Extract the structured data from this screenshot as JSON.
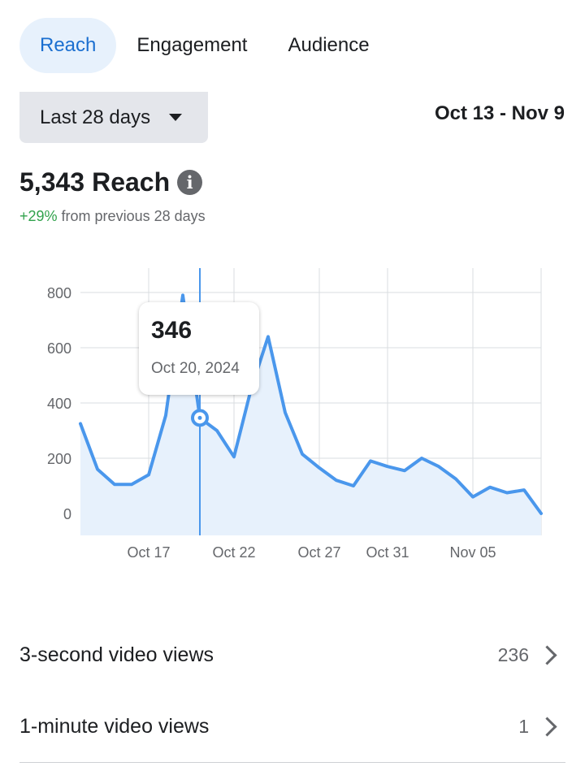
{
  "tabs": [
    {
      "label": "Reach",
      "active": true
    },
    {
      "label": "Engagement",
      "active": false
    },
    {
      "label": "Audience",
      "active": false
    }
  ],
  "range_selector": {
    "label": "Last 28 days"
  },
  "date_range": "Oct 13 - Nov 9",
  "metric": {
    "value": "5,343",
    "label": "Reach",
    "change": "+29%",
    "change_suffix": "from previous 28 days"
  },
  "tooltip": {
    "value": "346",
    "date": "Oct 20, 2024"
  },
  "colors": {
    "accent": "#1b6fd0",
    "line": "#4a97ec",
    "area": "#e7f1fc",
    "positive": "#31a24c"
  },
  "chart_data": {
    "type": "area",
    "x": [
      "Oct 13",
      "Oct 14",
      "Oct 15",
      "Oct 16",
      "Oct 17",
      "Oct 18",
      "Oct 19",
      "Oct 20",
      "Oct 21",
      "Oct 22",
      "Oct 23",
      "Oct 24",
      "Oct 25",
      "Oct 26",
      "Oct 27",
      "Oct 28",
      "Oct 29",
      "Oct 30",
      "Oct 31",
      "Nov 01",
      "Nov 02",
      "Nov 03",
      "Nov 04",
      "Nov 05",
      "Nov 06",
      "Nov 07",
      "Nov 08",
      "Nov 09"
    ],
    "series": [
      {
        "values": [
          325,
          160,
          105,
          105,
          140,
          355,
          790,
          346,
          300,
          205,
          450,
          640,
          365,
          215,
          165,
          120,
          100,
          190,
          170,
          155,
          200,
          170,
          125,
          60,
          95,
          75,
          85,
          0
        ]
      }
    ],
    "x_tick_labels": [
      "Oct 17",
      "Oct 22",
      "Oct 27",
      "Oct 31",
      "Nov 05"
    ],
    "y_ticks": [
      0,
      200,
      400,
      600,
      800
    ],
    "ylim": [
      -80,
      860
    ],
    "grid": true,
    "highlighted_point": "Oct 20"
  },
  "rows": [
    {
      "label": "3-second video views",
      "value": "236"
    },
    {
      "label": "1-minute video views",
      "value": "1"
    }
  ]
}
